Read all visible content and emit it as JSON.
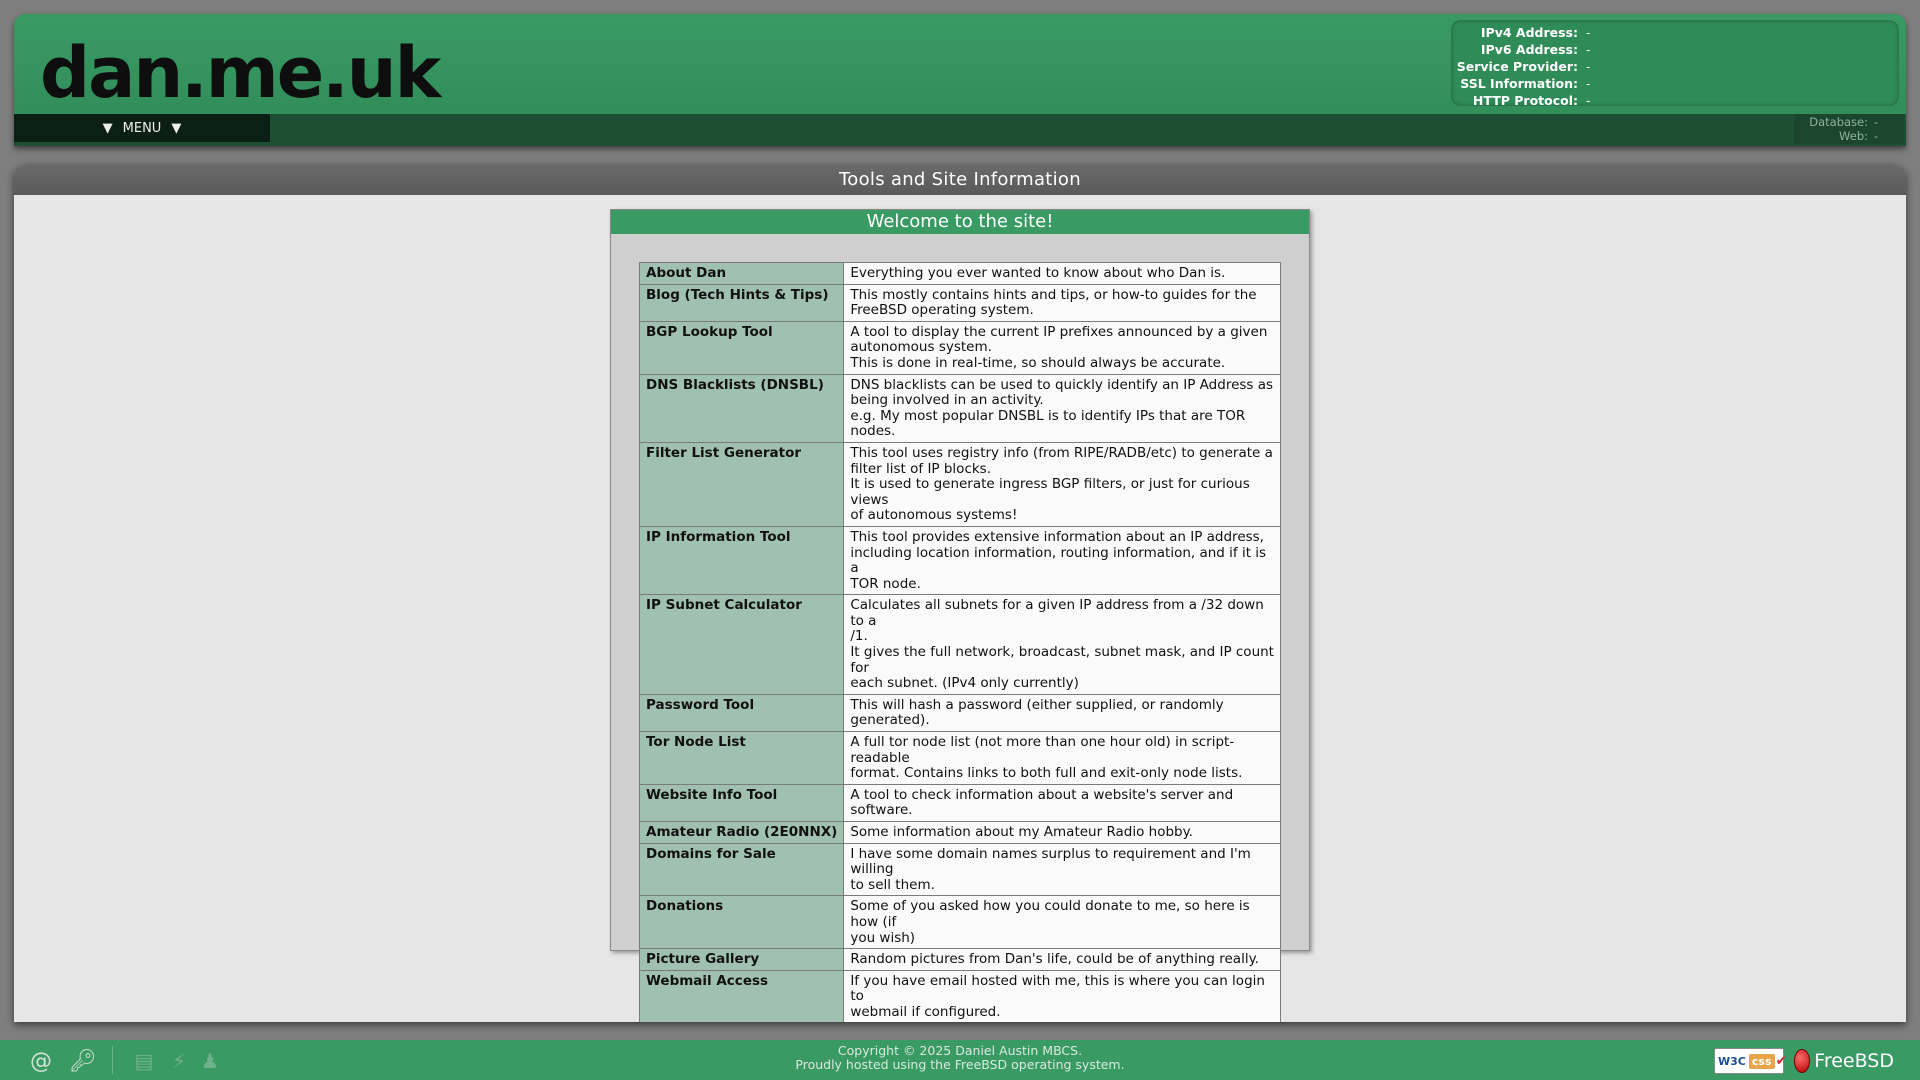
{
  "header": {
    "logo": "dan.me.uk",
    "menu_label": "MENU",
    "menu_arrow_left": "▼",
    "menu_arrow_right": "▼",
    "connection_info": [
      {
        "label": "IPv4 Address:",
        "value": "-"
      },
      {
        "label": "IPv6 Address:",
        "value": "-"
      },
      {
        "label": "Service Provider:",
        "value": "-"
      },
      {
        "label": "SSL Information:",
        "value": "-"
      },
      {
        "label": "HTTP Protocol:",
        "value": "-"
      }
    ],
    "server_info": [
      {
        "label": "Database:",
        "value": "-"
      },
      {
        "label": "Web:",
        "value": "-"
      }
    ]
  },
  "main": {
    "title": "Tools and Site Information",
    "welcome_title": "Welcome to the site!",
    "tools": [
      {
        "name": "About Dan",
        "lines": [
          "Everything you ever wanted to know about who Dan is."
        ]
      },
      {
        "name": "Blog (Tech Hints & Tips)",
        "lines": [
          "This mostly contains hints and tips, or how-to guides for the",
          "FreeBSD operating system."
        ]
      },
      {
        "name": "BGP Lookup Tool",
        "lines": [
          "A tool to display the current IP prefixes announced by a given",
          "autonomous system.",
          "This is done in real-time, so should always be accurate."
        ]
      },
      {
        "name": "DNS Blacklists (DNSBL)",
        "lines": [
          "DNS blacklists can be used to quickly identify an IP Address as",
          "being involved in an activity.",
          "e.g. My most popular DNSBL is to identify IPs that are TOR nodes."
        ]
      },
      {
        "name": "Filter List Generator",
        "lines": [
          "This tool uses registry info (from RIPE/RADB/etc) to generate a",
          "filter list of IP blocks.",
          "It is used to generate ingress BGP filters, or just for curious views",
          "of autonomous systems!"
        ]
      },
      {
        "name": "IP Information Tool",
        "lines": [
          "This tool provides extensive information about an IP address,",
          "including location information, routing information, and if it is a",
          "TOR node."
        ]
      },
      {
        "name": "IP Subnet Calculator",
        "lines": [
          "Calculates all subnets for a given IP address from a /32 down to a",
          "/1.",
          "It gives the full network, broadcast, subnet mask, and IP count for",
          "each subnet. (IPv4 only currently)"
        ]
      },
      {
        "name": "Password Tool",
        "lines": [
          "This will hash a password (either supplied, or randomly generated)."
        ]
      },
      {
        "name": "Tor Node List",
        "lines": [
          "A full tor node list (not more than one hour old) in script-readable",
          "format. Contains links to both full and exit-only node lists."
        ]
      },
      {
        "name": "Website Info Tool",
        "lines": [
          "A tool to check information about a website's server and software."
        ]
      },
      {
        "name": "Amateur Radio (2E0NNX)",
        "lines": [
          "Some information about my Amateur Radio hobby."
        ]
      },
      {
        "name": "Domains for Sale",
        "lines": [
          "I have some domain names surplus to requirement and I'm willing",
          "to sell them."
        ]
      },
      {
        "name": "Donations",
        "lines": [
          "Some of you asked how you could donate to me, so here is how (if",
          "you wish)"
        ]
      },
      {
        "name": "Picture Gallery",
        "lines": [
          "Random pictures from Dan's life, could be of anything really."
        ]
      },
      {
        "name": "Webmail Access",
        "lines": [
          "If you have email hosted with me, this is where you can login to",
          "webmail if configured."
        ]
      }
    ]
  },
  "footer": {
    "copyright": "Copyright © 2025 Daniel Austin MBCS.",
    "hosted": "Proudly hosted using the FreeBSD operating system.",
    "w3c_label": "W3C",
    "css_label": "css",
    "freebsd_label": "FreeBSD",
    "icons": [
      "at-icon",
      "key-icon",
      "id-card-icon",
      "lightning-icon",
      "person-icon"
    ]
  },
  "colors": {
    "brand_green": "#3a9a64",
    "dark_green": "#1e4f33",
    "tool_name_bg": "#a0c0b0"
  }
}
